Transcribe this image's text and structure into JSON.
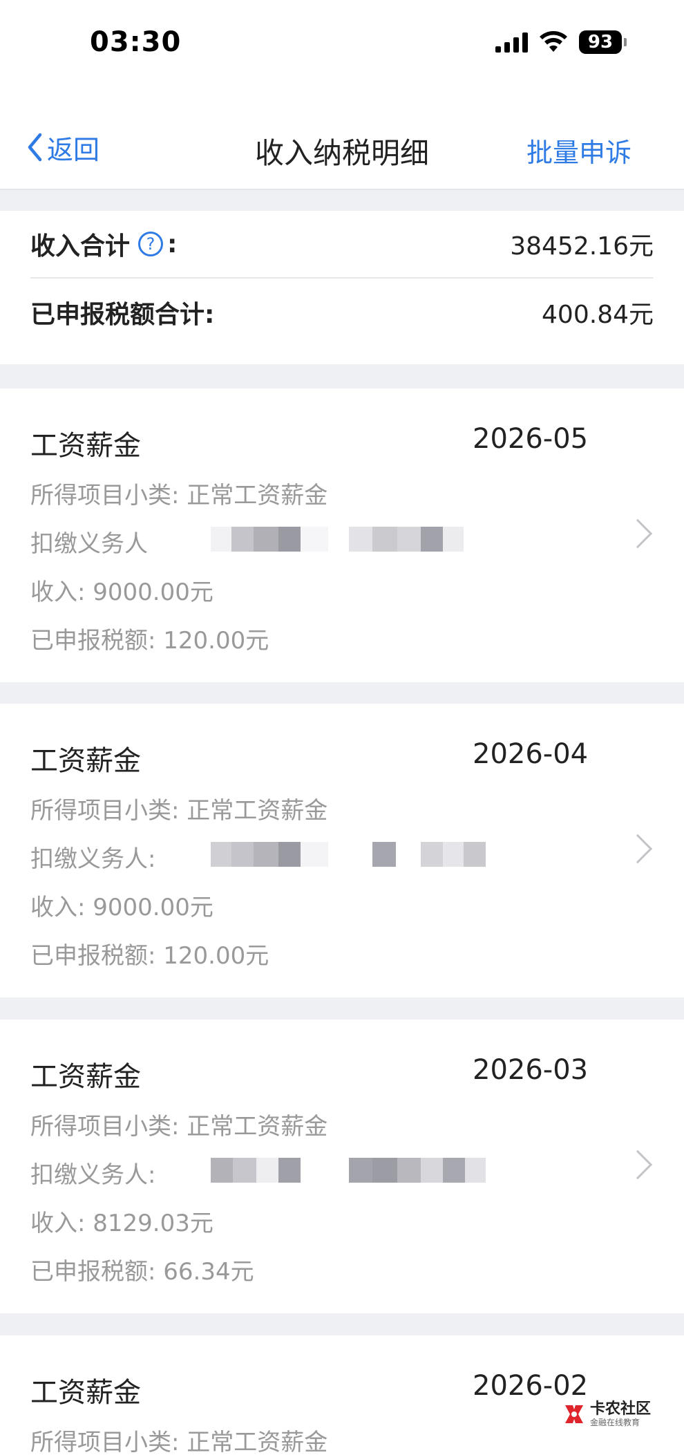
{
  "status_bar": {
    "time": "03:30",
    "battery": "93",
    "icons": [
      "signal-icon",
      "wifi-icon",
      "battery-icon"
    ]
  },
  "nav": {
    "back_label": "返回",
    "title": "收入纳税明细",
    "batch_label": "批量申诉"
  },
  "summary": {
    "income_total_label": "收入合计",
    "income_total_colon": ":",
    "income_total_value": "38452.16元",
    "tax_total_label": "已申报税额合计:",
    "tax_total_value": "400.84元"
  },
  "records": [
    {
      "title": "工资薪金",
      "date": "2026-05",
      "subcategory": "所得项目小类: 正常工资薪金",
      "withholder": "扣缴义务人",
      "income": "收入: 9000.00元",
      "tax": "已申报税额: 120.00元"
    },
    {
      "title": "工资薪金",
      "date": "2026-04",
      "subcategory": "所得项目小类: 正常工资薪金",
      "withholder": "扣缴义务人:",
      "income": "收入: 9000.00元",
      "tax": "已申报税额: 120.00元"
    },
    {
      "title": "工资薪金",
      "date": "2026-03",
      "subcategory": "所得项目小类: 正常工资薪金",
      "withholder": "扣缴义务人:",
      "income": "收入: 8129.03元",
      "tax": "已申报税额: 66.34元"
    },
    {
      "title": "工资薪金",
      "date": "2026-02",
      "subcategory": "所得项目小类: 正常工资薪金"
    }
  ],
  "watermark": {
    "main": "卡农社区",
    "sub": "金融在线教育"
  },
  "colors": {
    "accent": "#2f7be5",
    "background": "#eef0f4",
    "secondary_text": "#999999"
  }
}
